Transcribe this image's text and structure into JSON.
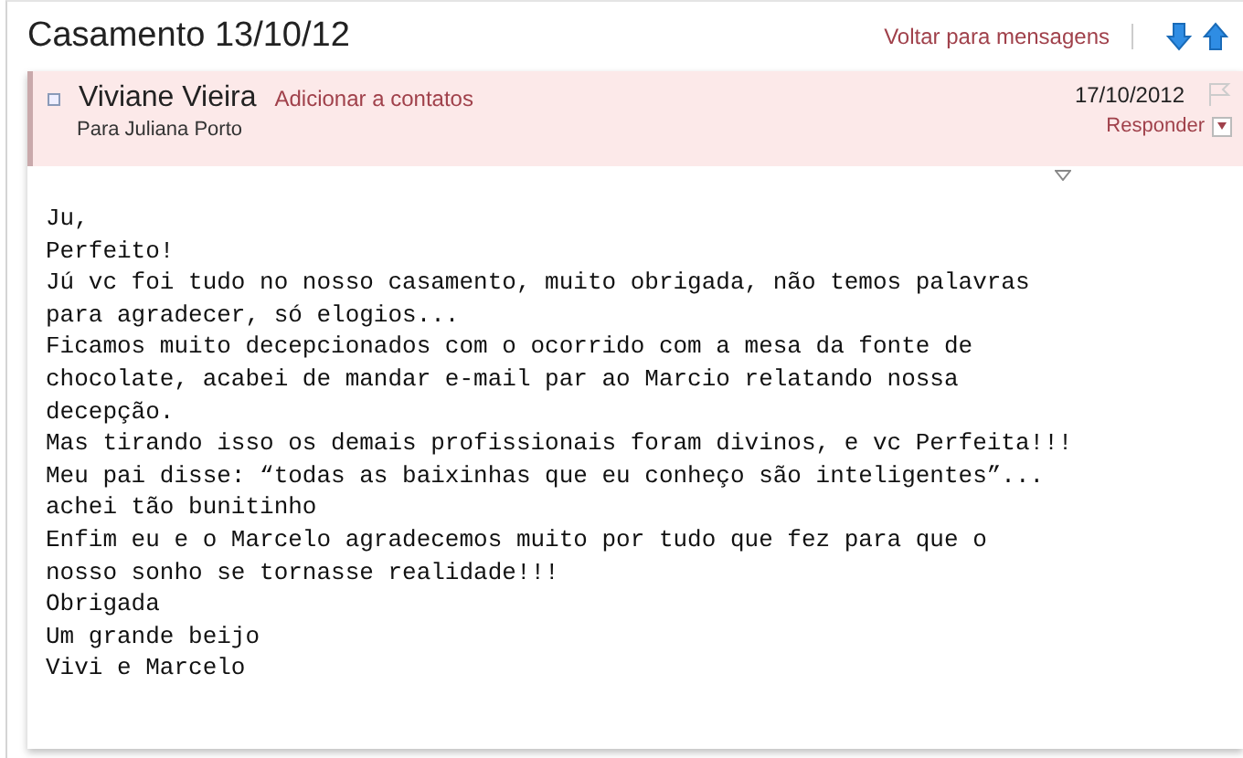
{
  "title": "Casamento 13/10/12",
  "back_link": "Voltar para mensagens",
  "message": {
    "sender": "Viviane Vieira",
    "add_contact": "Adicionar a contatos",
    "recipient": "Para Juliana Porto",
    "date": "17/10/2012",
    "flagged": false,
    "reply": "Responder",
    "body": [
      "Ju,",
      "Perfeito!",
      "Jú vc foi tudo no nosso casamento, muito obrigada, não temos palavras",
      "para agradecer, só elogios...",
      "Ficamos muito decepcionados com o ocorrido com a mesa da fonte de",
      "chocolate, acabei de mandar e-mail par ao Marcio relatando nossa",
      "decepção.",
      "Mas tirando isso os demais profissionais foram divinos, e vc Perfeita!!!",
      "Meu pai disse: “todas as baixinhas que eu conheço são inteligentes”...",
      "achei tão bunitinho",
      "Enfim eu e o Marcelo agradecemos muito por tudo que fez para que o",
      "nosso sonho se tornasse realidade!!!",
      "Obrigada",
      "Um grande beijo",
      "Vivi e Marcelo"
    ]
  }
}
